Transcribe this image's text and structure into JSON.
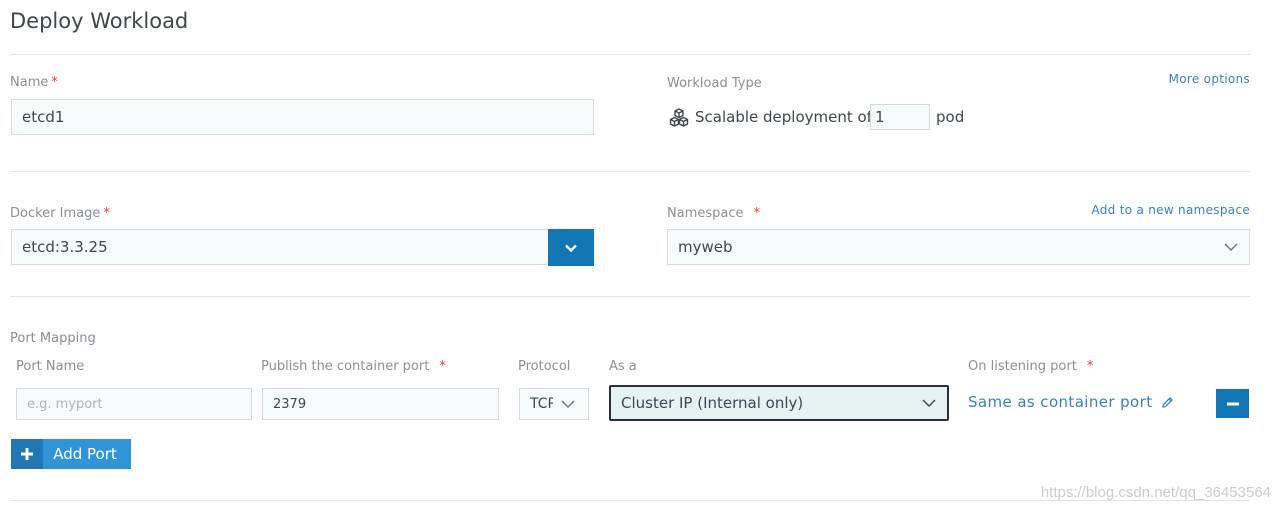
{
  "page": {
    "title": "Deploy Workload"
  },
  "name": {
    "label": "Name",
    "required_mark": "*",
    "value": "etcd1"
  },
  "workload_type": {
    "label": "Workload Type",
    "more_options": "More options",
    "prefix": "Scalable deployment of",
    "count": "1",
    "suffix": "pod",
    "icon": "cubes-icon"
  },
  "docker_image": {
    "label": "Docker Image",
    "required_mark": "*",
    "value": "etcd:3.3.25",
    "toggle_icon": "chevron-down-icon"
  },
  "namespace": {
    "label": "Namespace",
    "required_mark": "*",
    "add_link": "Add to a new namespace",
    "value": "myweb"
  },
  "port_mapping": {
    "label": "Port Mapping",
    "columns": {
      "port_name": "Port Name",
      "publish": "Publish the container port",
      "publish_required": "*",
      "protocol": "Protocol",
      "as_a": "As a",
      "listening": "On listening port",
      "listening_required": "*"
    },
    "row": {
      "port_name_placeholder": "e.g. myport",
      "publish_value": "2379",
      "protocol_value": "TCP",
      "as_a_value": "Cluster IP (Internal only)",
      "listening_value": "Same as container port"
    },
    "add_port_label": "Add Port",
    "add_port_icon": "plus-icon",
    "remove_icon": "minus-icon"
  },
  "watermark": "https://blog.csdn.net/qq_36453564",
  "colors": {
    "accent": "#1376b4",
    "link": "#3d80b8",
    "required": "#e53935",
    "focus_border": "#2c3038",
    "focus_bg": "#e5f3f3"
  }
}
